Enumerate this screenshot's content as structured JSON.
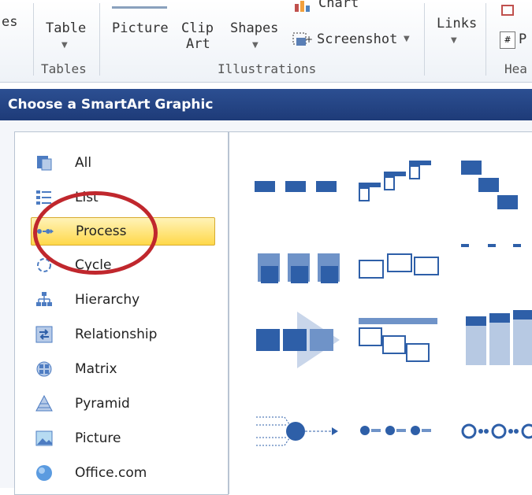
{
  "ribbon": {
    "partial_left_label": "es",
    "table_label": "Table",
    "picture_label": "Picture",
    "clipart_label_line1": "Clip",
    "clipart_label_line2": "Art",
    "shapes_label": "Shapes",
    "chart_label": "Chart",
    "screenshot_label": "Screenshot",
    "links_label": "Links",
    "partial_right_label": "P",
    "groups": {
      "tables": "Tables",
      "illustrations": "Illustrations",
      "header_partial": "Hea"
    }
  },
  "dialog": {
    "title": "Choose a SmartArt Graphic",
    "selected_category": "Process",
    "categories": [
      {
        "label": "All",
        "icon": "all-icon"
      },
      {
        "label": "List",
        "icon": "list-icon"
      },
      {
        "label": "Process",
        "icon": "process-icon"
      },
      {
        "label": "Cycle",
        "icon": "cycle-icon"
      },
      {
        "label": "Hierarchy",
        "icon": "hierarchy-icon"
      },
      {
        "label": "Relationship",
        "icon": "relationship-icon"
      },
      {
        "label": "Matrix",
        "icon": "matrix-icon"
      },
      {
        "label": "Pyramid",
        "icon": "pyramid-icon"
      },
      {
        "label": "Picture",
        "icon": "picture-icon"
      },
      {
        "label": "Office.com",
        "icon": "globe-icon"
      }
    ],
    "annotation_color": "#c0272d",
    "accent_color": "#2e5fa8"
  }
}
